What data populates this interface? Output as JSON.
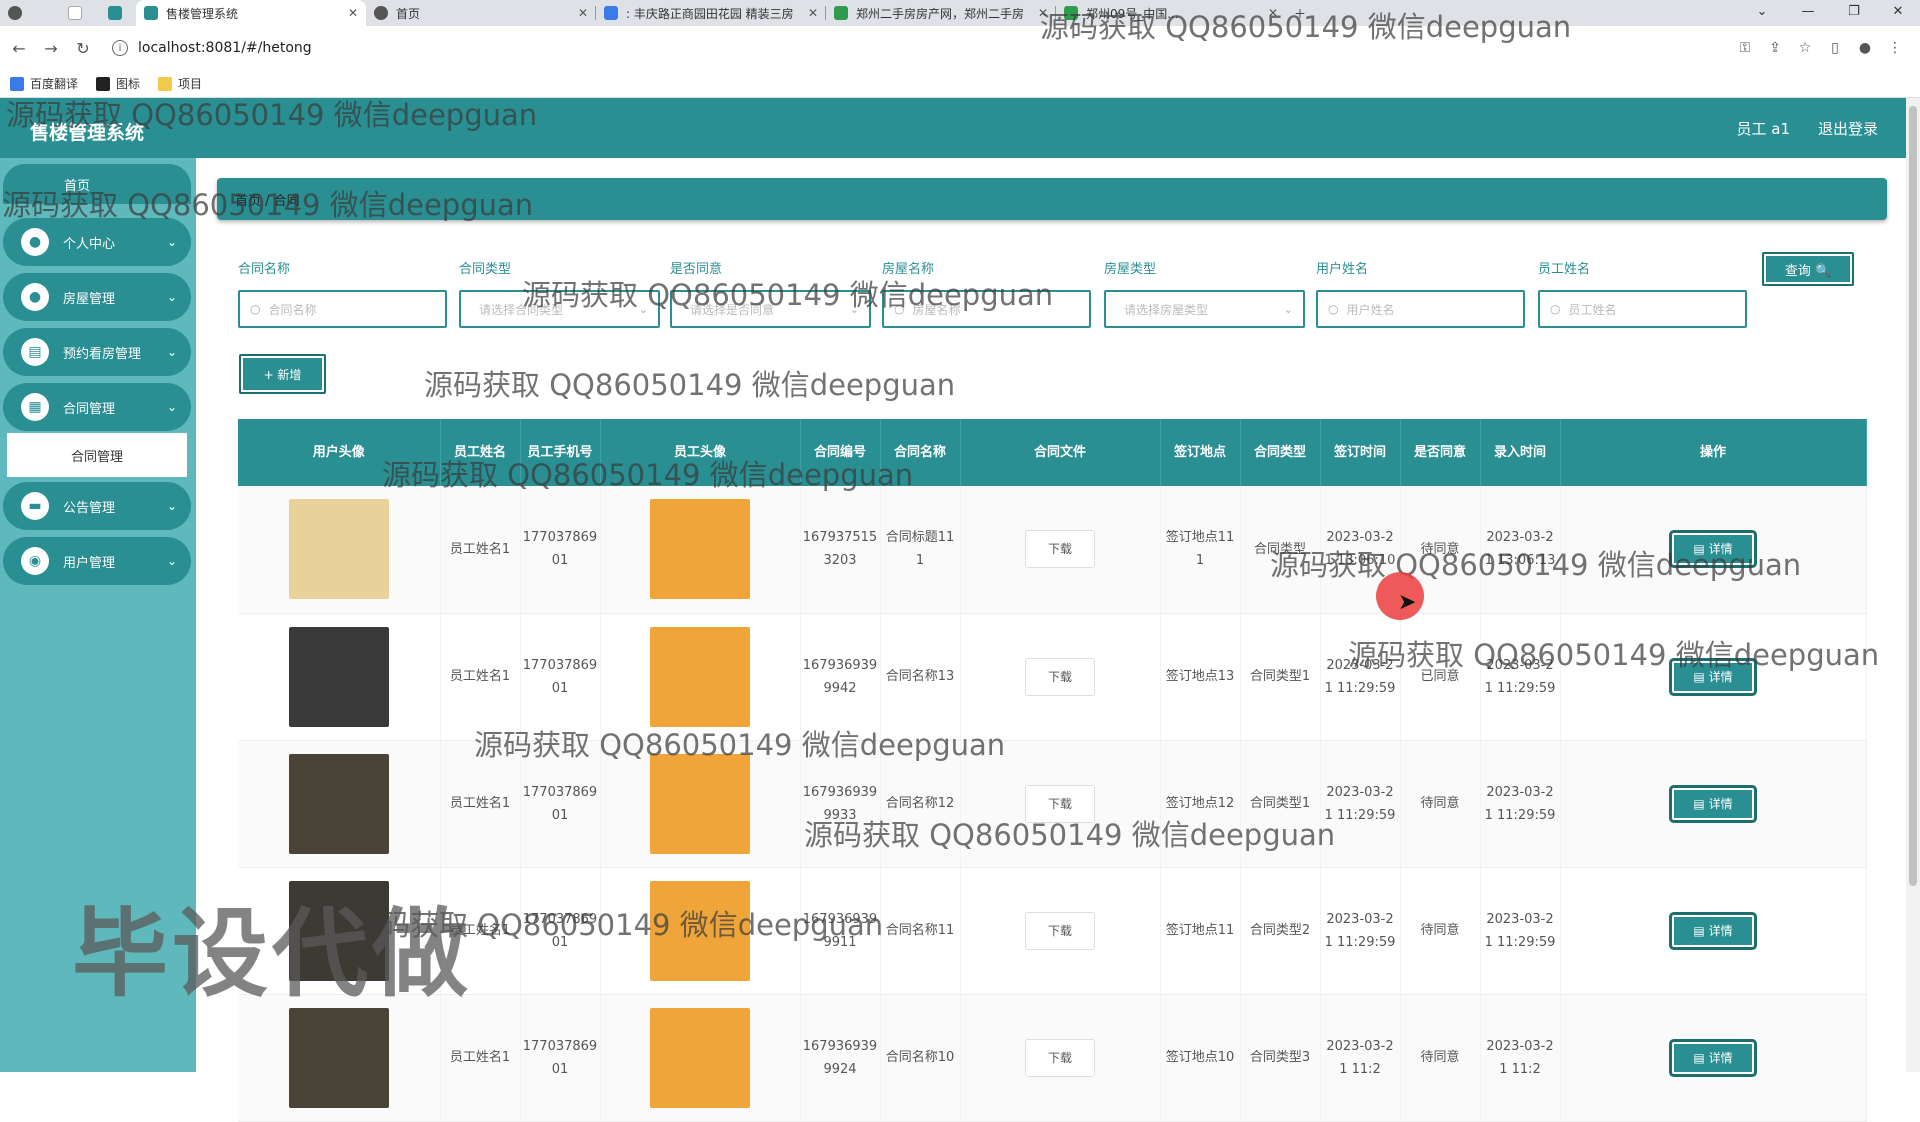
{
  "browser": {
    "tabs": [
      {
        "title": "售楼管理系统",
        "active": true,
        "color": "#2a8f93"
      },
      {
        "title": "首页",
        "active": false,
        "color": "#555"
      },
      {
        "title": ": 丰庆路正商园田花园 精装三房",
        "active": false,
        "color": "#3b7be8"
      },
      {
        "title": "郑州二手房房产网，郑州二手房",
        "active": false,
        "color": "#2e9b4d"
      },
      {
        "title": "郑州09号_中国...",
        "active": false,
        "color": "#2e9b4d"
      }
    ],
    "url": "localhost:8081/#/hetong",
    "bookmarks": [
      "百度翻译",
      "图标",
      "项目"
    ]
  },
  "header": {
    "title": "售楼管理系统",
    "user": "员工 a1",
    "logout": "退出登录"
  },
  "sidebar": {
    "home": "首页",
    "items": [
      {
        "label": "个人中心",
        "icon": "user-icon"
      },
      {
        "label": "房屋管理",
        "icon": "user-icon"
      },
      {
        "label": "预约看房管理",
        "icon": "calendar-icon"
      },
      {
        "label": "合同管理",
        "icon": "grid-icon"
      },
      {
        "label": "公告管理",
        "icon": "notice-icon"
      },
      {
        "label": "用户管理",
        "icon": "location-icon"
      }
    ],
    "sub_active": "合同管理"
  },
  "breadcrumb": "首页 / 合同",
  "filters": [
    {
      "label": "合同名称",
      "placeholder": "合同名称",
      "type": "input"
    },
    {
      "label": "合同类型",
      "placeholder": "请选择合同类型",
      "type": "select"
    },
    {
      "label": "是否同意",
      "placeholder": "请选择是否同意",
      "type": "select"
    },
    {
      "label": "房屋名称",
      "placeholder": "房屋名称",
      "type": "input"
    },
    {
      "label": "房屋类型",
      "placeholder": "请选择房屋类型",
      "type": "select"
    },
    {
      "label": "用户姓名",
      "placeholder": "用户姓名",
      "type": "input"
    },
    {
      "label": "员工姓名",
      "placeholder": "员工姓名",
      "type": "input"
    }
  ],
  "buttons": {
    "query": "查询 🔍",
    "add": "+ 新增",
    "download": "下载",
    "detail": "▤ 详情"
  },
  "table": {
    "headers": [
      "用户头像",
      "员工姓名",
      "员工手机号",
      "员工头像",
      "合同编号",
      "合同名称",
      "合同文件",
      "签订地点",
      "合同类型",
      "签订时间",
      "是否同意",
      "录入时间",
      "操作"
    ],
    "rows": [
      {
        "emp_name": "员工姓名1",
        "phone": "17703786901",
        "contract_no": "1679375153203",
        "contract_name": "合同标题111",
        "place": "签订地点111",
        "type": "合同类型",
        "sign_time": "2023-03-21 13:06:10",
        "agree": "待同意",
        "entry_time": "2023-03-21 13:06:13"
      },
      {
        "emp_name": "员工姓名1",
        "phone": "17703786901",
        "contract_no": "1679369399942",
        "contract_name": "合同名称13",
        "place": "签订地点13",
        "type": "合同类型1",
        "sign_time": "2023-03-21 11:29:59",
        "agree": "已同意",
        "entry_time": "2023-03-21 11:29:59"
      },
      {
        "emp_name": "员工姓名1",
        "phone": "17703786901",
        "contract_no": "1679369399933",
        "contract_name": "合同名称12",
        "place": "签订地点12",
        "type": "合同类型1",
        "sign_time": "2023-03-21 11:29:59",
        "agree": "待同意",
        "entry_time": "2023-03-21 11:29:59"
      },
      {
        "emp_name": "员工姓名1",
        "phone": "17703786901",
        "contract_no": "1679369399911",
        "contract_name": "合同名称11",
        "place": "签订地点11",
        "type": "合同类型2",
        "sign_time": "2023-03-21 11:29:59",
        "agree": "待同意",
        "entry_time": "2023-03-21 11:29:59"
      },
      {
        "emp_name": "员工姓名1",
        "phone": "17703786901",
        "contract_no": "1679369399924",
        "contract_name": "合同名称10",
        "place": "签订地点10",
        "type": "合同类型3",
        "sign_time": "2023-03-21 11:2",
        "agree": "待同意",
        "entry_time": "2023-03-21 11:2"
      }
    ]
  },
  "watermark_text": "源码获取 QQ86050149 微信deepguan",
  "stamp_text": "毕设代做",
  "colors": {
    "primary": "#2a8f93",
    "sidebar": "#5fb8bb"
  }
}
